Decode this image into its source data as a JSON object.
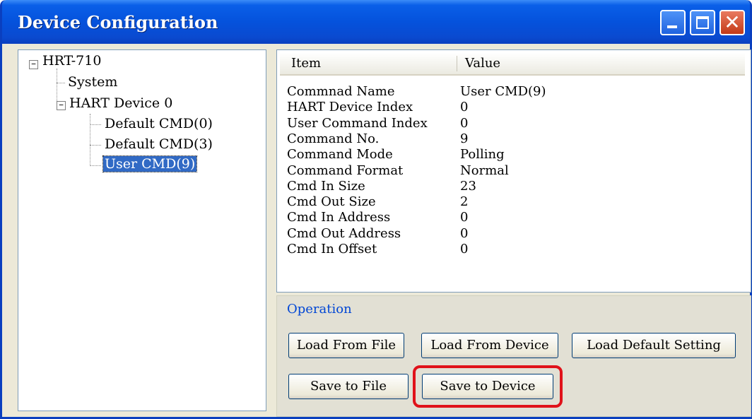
{
  "window": {
    "title": "Device Configuration",
    "controls": {
      "minimize_icon": "minimize-icon",
      "maximize_icon": "maximize-icon",
      "close_icon": "close-icon",
      "close_glyph": "✕"
    }
  },
  "tree": {
    "expander_glyph": "−",
    "root": "HRT-710",
    "system": "System",
    "device": "HART Device 0",
    "commands": [
      "Default CMD(0)",
      "Default CMD(3)",
      "User CMD(9)"
    ],
    "selected": "User CMD(9)"
  },
  "properties": {
    "columns": [
      "Item",
      "Value"
    ],
    "rows": [
      [
        "Commnad Name",
        "User CMD(9)"
      ],
      [
        "HART Device Index",
        "0"
      ],
      [
        "User Command Index",
        "0"
      ],
      [
        "Command No.",
        "9"
      ],
      [
        "Command Mode",
        "Polling"
      ],
      [
        "Command Format",
        "Normal"
      ],
      [
        "Cmd In Size",
        "23"
      ],
      [
        "Cmd Out Size",
        "2"
      ],
      [
        "Cmd In Address",
        "0"
      ],
      [
        "Cmd Out Address",
        "0"
      ],
      [
        "Cmd In Offset",
        "0"
      ]
    ]
  },
  "operation": {
    "label": "Operation",
    "buttons": {
      "load_from_file": "Load From File",
      "load_from_device": "Load From Device",
      "load_default": "Load Default Setting",
      "save_to_file": "Save to File",
      "save_to_device": "Save to Device"
    },
    "highlighted_button": "Save to Device",
    "highlight_color": "#e0121a"
  },
  "colors": {
    "titlebar": "#0552dc",
    "selection": "#316ac5",
    "operation_label": "#0046d5"
  }
}
